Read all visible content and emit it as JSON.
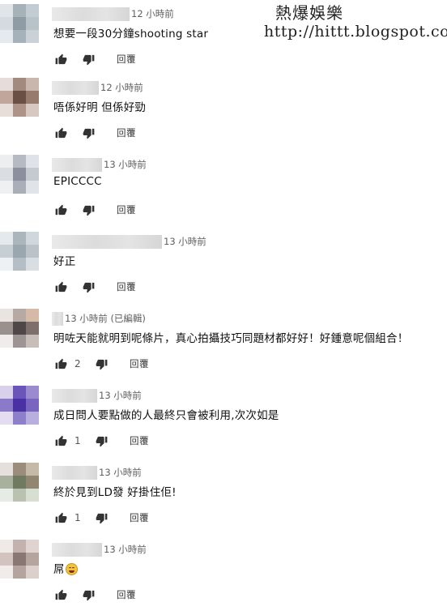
{
  "watermark": {
    "title": "熱爆娛樂",
    "url": "http://hittt.blogspot.com"
  },
  "reply_label": "回覆",
  "comments": [
    {
      "time": "12 小時前",
      "text": "想要一段30分鐘shooting star",
      "likes": "",
      "name_width": 96,
      "avatar": [
        "#dfe5ea",
        "#a6b1b9",
        "#c2ccd3",
        "#d3dbe1",
        "#8f9ca6",
        "#b7c2ca",
        "#e5eaee",
        "#a5b2bb",
        "#c9d2d8"
      ]
    },
    {
      "time": "12 小時前",
      "text": "唔係好明 但係好勁",
      "likes": "",
      "name_width": 58,
      "avatar": [
        "#e7dcd8",
        "#a58a7c",
        "#cbb6ac",
        "#c3a799",
        "#6d4e42",
        "#9a7b6c",
        "#e8ded9",
        "#b09486",
        "#d8c8c0"
      ]
    },
    {
      "time": "13 小時前",
      "text": "EPICCCC",
      "likes": "",
      "name_width": 62,
      "avatar": [
        "#eceef0",
        "#b6bac3",
        "#dfe2e6",
        "#dadde2",
        "#8a8fa0",
        "#c5c9d1",
        "#eef0f2",
        "#a9aeb9",
        "#e0e3e7"
      ]
    },
    {
      "time": "13 小時前",
      "text": "好正",
      "likes": "",
      "name_width": 136,
      "avatar": [
        "#e4e9ec",
        "#aab5bd",
        "#d0d8dd",
        "#c5cfd5",
        "#9aa7b0",
        "#b8c3ca",
        "#eef1f3",
        "#b3bec5",
        "#d7dee2"
      ]
    },
    {
      "time": "13 小時前 (已編輯)",
      "text": "明咗天能就明到呢條片，真心拍攝技巧同題材都好好！好鍾意呢個組合！",
      "likes": "2",
      "name_width": 14,
      "avatar": [
        "#e9e4e2",
        "#b8a9a3",
        "#d9b8a4",
        "#9b908c",
        "#4f4747",
        "#7d6f6b",
        "#efeceb",
        "#9e9593",
        "#c8beb9"
      ]
    },
    {
      "time": "13 小時前",
      "text": "成日問人要點做的人最終只會被利用,次次如是",
      "likes": "1",
      "name_width": 56,
      "avatar": [
        "#d9d0ef",
        "#6b55c2",
        "#9b8ad6",
        "#8c79d1",
        "#4a2fae",
        "#7a64c9",
        "#e4ddf4",
        "#8f7ed2",
        "#b9aee3"
      ]
    },
    {
      "time": "13 小時前",
      "text": "終於見到LD發 好掛住佢!",
      "likes": "1",
      "name_width": 56,
      "avatar": [
        "#e5e0db",
        "#9c8d78",
        "#c6b9a6",
        "#a9b09c",
        "#6e7a5e",
        "#94866f",
        "#e3ece4",
        "#b8c2b0",
        "#d5dfd0"
      ]
    },
    {
      "time": "13 小時前",
      "text": "屌",
      "likes": "",
      "name_width": 62,
      "emoji": "grinning-sweat",
      "avatar": [
        "#efeae8",
        "#c3b3ad",
        "#e0d4cf",
        "#d3c3bd",
        "#8a7772",
        "#b8a59e",
        "#f1ecea",
        "#b5a49e",
        "#dcd0cb"
      ]
    }
  ]
}
